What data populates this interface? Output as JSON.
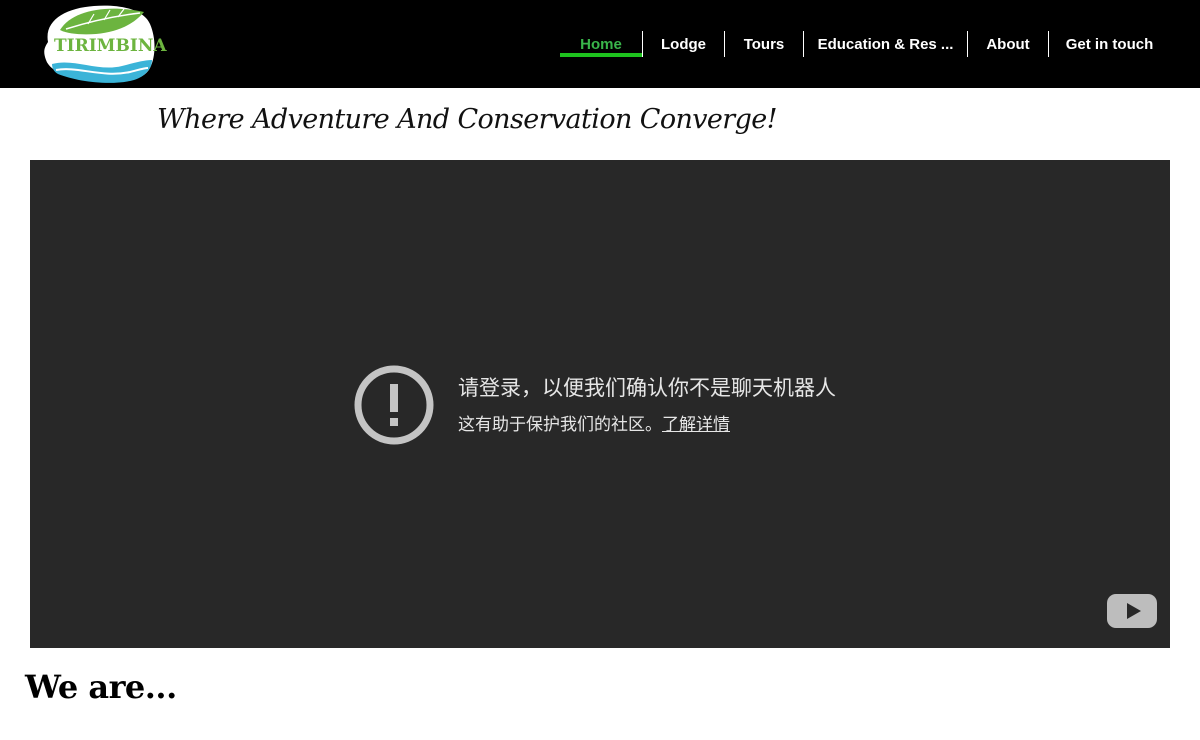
{
  "header": {
    "logo_text": "TIRIMBINA",
    "nav": [
      {
        "label": "Home",
        "active": true
      },
      {
        "label": "Lodge"
      },
      {
        "label": "Tours"
      },
      {
        "label": "Education & Res ..."
      },
      {
        "label": "About"
      },
      {
        "label": "Get in touch"
      }
    ]
  },
  "tagline": "Where Adventure And Conservation Converge!",
  "video": {
    "title": "请登录，以便我们确认你不是聊天机器人",
    "subtitle": "这有助于保护我们的社区。",
    "link": "了解详情",
    "icons": [
      "alert-circle-icon",
      "youtube-logo-icon"
    ]
  },
  "section": {
    "heading": "We are..."
  },
  "colors": {
    "header_bg": "#000000",
    "accent": "#39b54a",
    "active_underline": "#1ec21e",
    "video_bg": "#282828"
  }
}
